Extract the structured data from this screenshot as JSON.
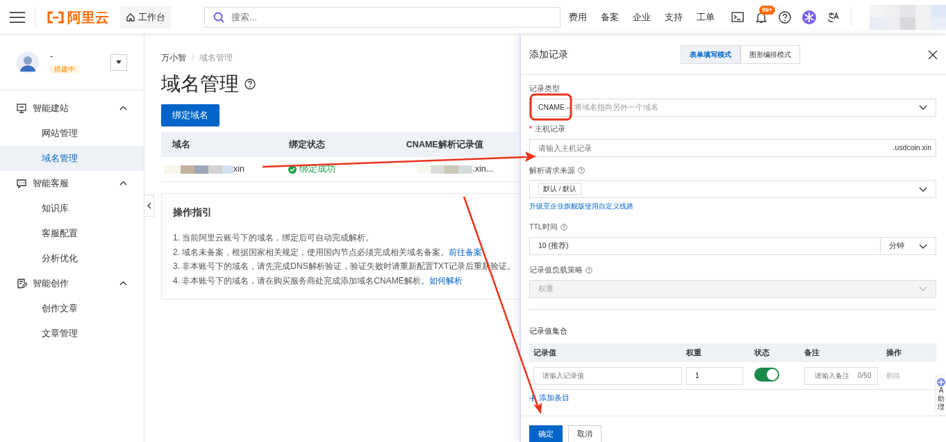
{
  "topbar": {
    "brand": "阿里云",
    "workbench": "工作台",
    "search_placeholder": "搜索...",
    "nav": [
      "费用",
      "备案",
      "企业",
      "支持",
      "工单"
    ],
    "badge": "99+"
  },
  "sidebar": {
    "profile": {
      "name": "-",
      "status": "搭建中"
    },
    "groups": [
      {
        "label": "智能建站",
        "expanded": true,
        "items": [
          {
            "label": "网站管理",
            "selected": false
          },
          {
            "label": "域名管理",
            "selected": true
          }
        ]
      },
      {
        "label": "智能客服",
        "expanded": true,
        "items": [
          {
            "label": "知识库",
            "selected": false
          },
          {
            "label": "客服配置",
            "selected": false
          },
          {
            "label": "分析优化",
            "selected": false
          }
        ]
      },
      {
        "label": "智能创作",
        "expanded": true,
        "items": [
          {
            "label": "创作文章",
            "selected": false
          },
          {
            "label": "文章管理",
            "selected": false
          }
        ]
      }
    ]
  },
  "main": {
    "breadcrumb": [
      "万小智",
      "域名管理"
    ],
    "breadcrumb_separator": "/",
    "title": "域名管理",
    "bind_button": "绑定域名",
    "table": {
      "columns": [
        "域名",
        "绑定状态",
        "CNAME解析记录值"
      ],
      "rows": [
        {
          "domain": "xin",
          "status": "绑定成功",
          "cname": ".xin..."
        }
      ]
    },
    "guide": {
      "title": "操作指引",
      "items": [
        {
          "text": "1. 当前阿里云账号下的域名，绑定后可自动完成解析。"
        },
        {
          "text": "2. 域名未备案，根据国家相关规定，使用国内节点必须完成相关域名备案。",
          "link": "前往备案"
        },
        {
          "text": "3. 非本账号下的域名，请先完成DNS解析验证，验证失败时请重新配置TXT记录后重新验证。"
        },
        {
          "text": "4. 非本账号下的域名，请在购买服务商处完成添加域名CNAME解析。",
          "link": "如何解析"
        }
      ]
    }
  },
  "drawer": {
    "title": "添加记录",
    "modes": [
      {
        "label": "表单填写模式",
        "selected": true
      },
      {
        "label": "图形编排模式",
        "selected": false
      }
    ],
    "record_type": {
      "label": "记录类型",
      "value": "CNAME --",
      "hint": "将域名指向另外一个域名"
    },
    "host": {
      "label": "主机记录",
      "required_mark": "*",
      "placeholder": "请输入主机记录",
      "suffix": ".usdcoin.xin"
    },
    "source": {
      "label": "解析请求来源",
      "tag": "默认 / 默认",
      "link": "升级至企业旗舰版使用自定义线路"
    },
    "ttl": {
      "label": "TTL时间",
      "value": "10 (推荐)",
      "unit": "分钟"
    },
    "strategy": {
      "label": "记录值负载策略",
      "value": "权重",
      "disabled": true
    },
    "records_title": "记录值集合",
    "columns": [
      "记录值",
      "权重",
      "状态",
      "备注",
      "操作"
    ],
    "records": [
      {
        "value_placeholder": "请输入记录值",
        "weight": "1",
        "enabled": true,
        "note_placeholder": "请输入备注",
        "count": "0/50",
        "action": "删除"
      }
    ],
    "add": "添加条目",
    "ok": "确定",
    "cancel": "取消"
  },
  "assistant_tab": [
    "A",
    "助",
    "理"
  ]
}
